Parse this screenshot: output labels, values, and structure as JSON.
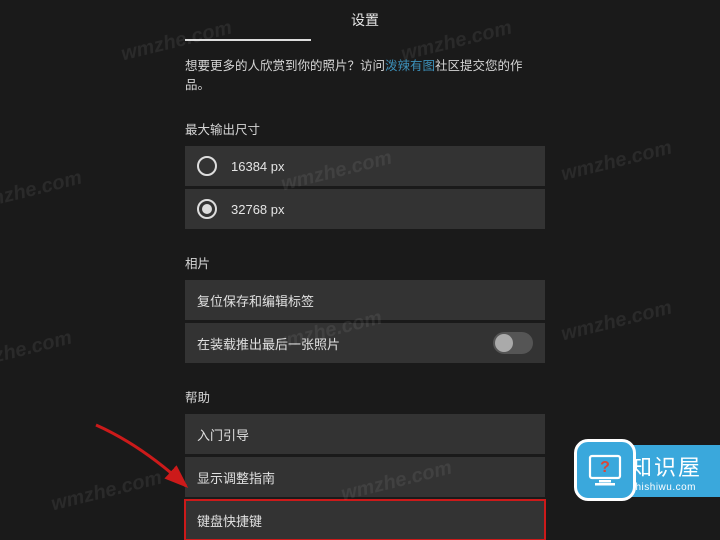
{
  "title": "设置",
  "prompt": {
    "before": "想要更多的人欣赏到你的照片？访问",
    "link": "泼辣有图",
    "after": "社区提交您的作品。"
  },
  "output": {
    "label": "最大输出尺寸",
    "options": [
      {
        "label": "16384 px",
        "selected": false
      },
      {
        "label": "32768 px",
        "selected": true
      }
    ]
  },
  "photo": {
    "label": "相片",
    "reset": "复位保存和编辑标签",
    "pushLast": "在装载推出最后一张照片",
    "pushLastOn": false
  },
  "help": {
    "label": "帮助",
    "items": [
      "入门引导",
      "显示调整指南",
      "键盘快捷键"
    ]
  },
  "watermark": "wmzhe.com",
  "brand": {
    "name": "知识屋",
    "sub": "zhishiwu.com"
  }
}
